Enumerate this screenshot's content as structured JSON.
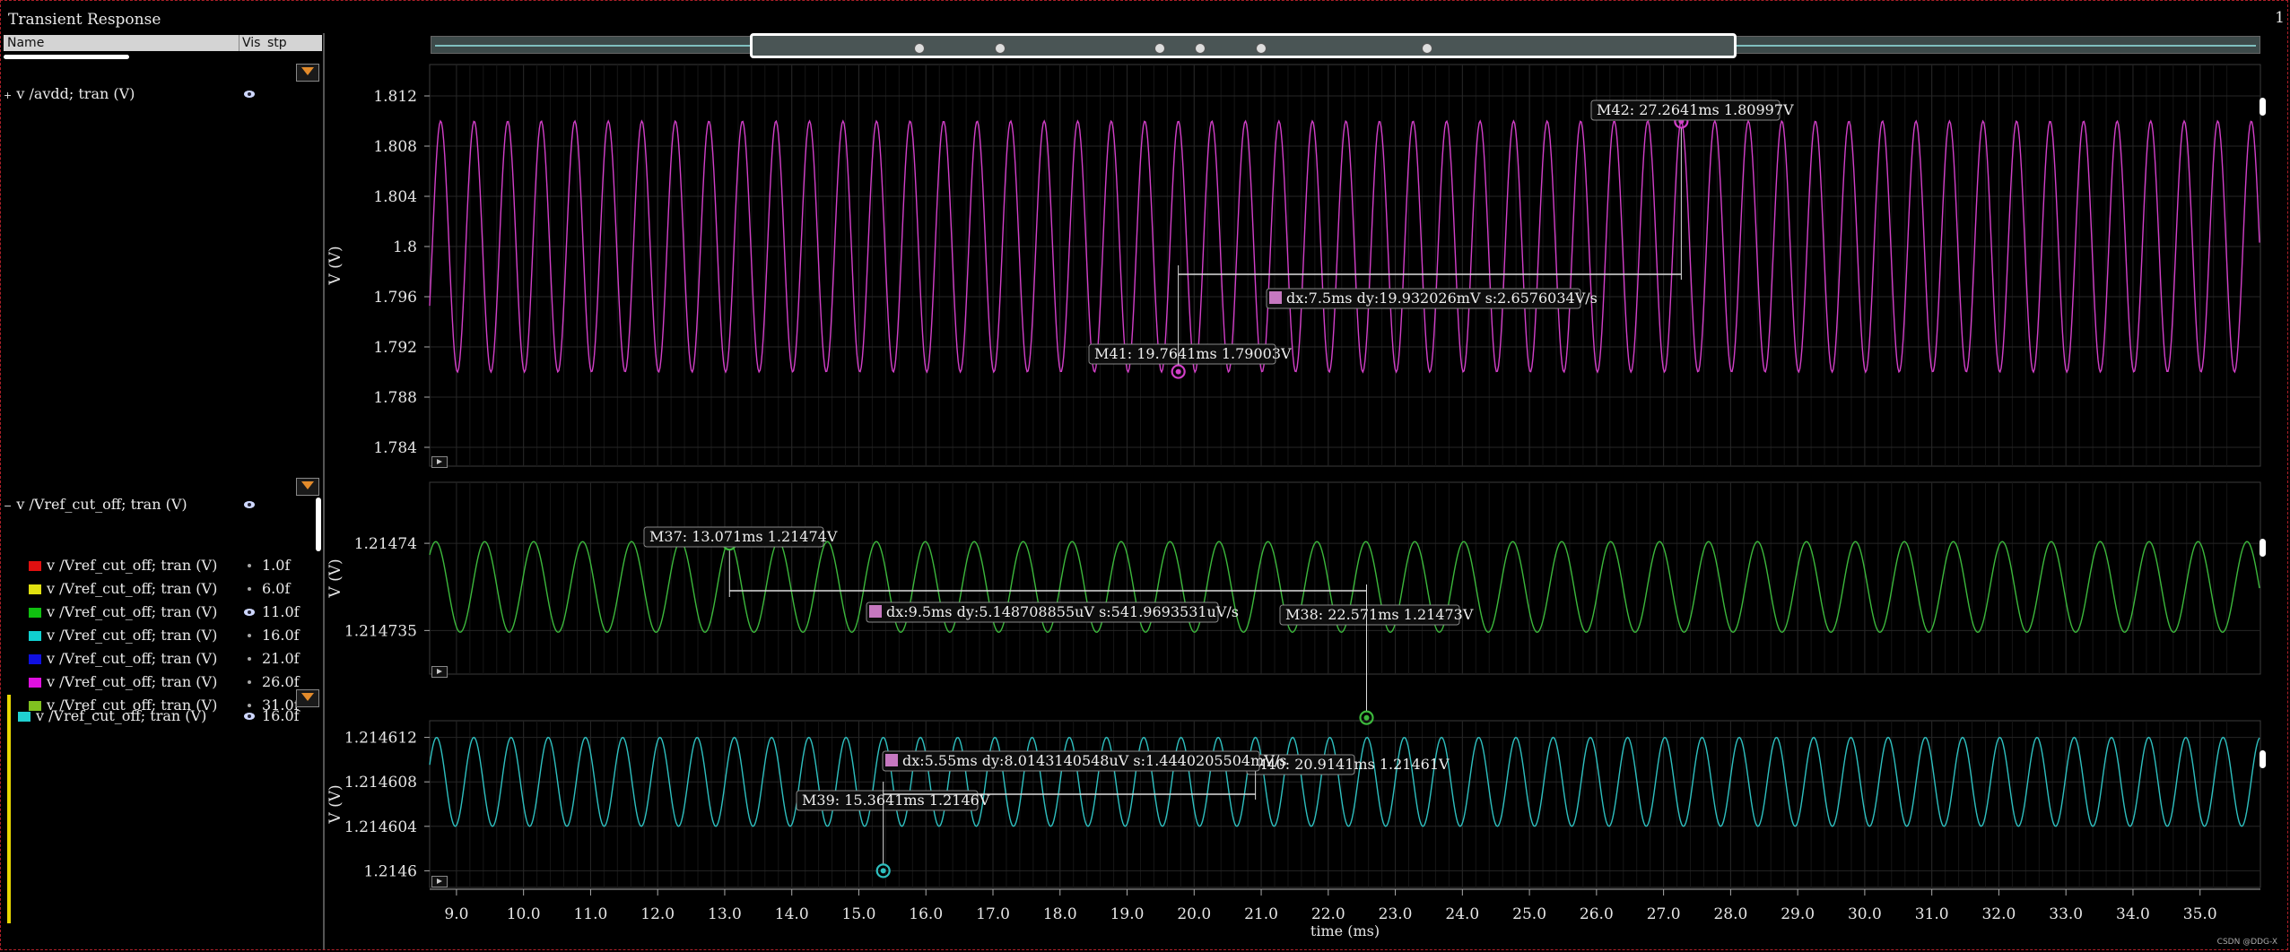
{
  "window": {
    "title": "Transient Response",
    "page_indicator": "1",
    "credit": "CSDN @DDG-X"
  },
  "browser": {
    "col_name": "Name",
    "col_vis": "Vis",
    "col_stp": "stp",
    "groups": [
      {
        "label": "v /avdd; tran (V)",
        "expand": "+"
      },
      {
        "label": "v /Vref_cut_off; tran (V)",
        "expand": "−",
        "children": [
          {
            "label": "v /Vref_cut_off; tran (V)",
            "stp": "1.0f",
            "color": "#e01010",
            "visible": false
          },
          {
            "label": "v /Vref_cut_off; tran (V)",
            "stp": "6.0f",
            "color": "#e0e010",
            "visible": false
          },
          {
            "label": "v /Vref_cut_off; tran (V)",
            "stp": "11.0f",
            "color": "#10c010",
            "visible": true
          },
          {
            "label": "v /Vref_cut_off; tran (V)",
            "stp": "16.0f",
            "color": "#10d0d0",
            "visible": false
          },
          {
            "label": "v /Vref_cut_off; tran (V)",
            "stp": "21.0f",
            "color": "#1010e0",
            "visible": false
          },
          {
            "label": "v /Vref_cut_off; tran (V)",
            "stp": "26.0f",
            "color": "#e010e0",
            "visible": false
          },
          {
            "label": "v /Vref_cut_off; tran (V)",
            "stp": "31.0f",
            "color": "#80c020",
            "visible": false
          }
        ]
      },
      {
        "label": "v /Vref_cut_off; tran (V)",
        "stp": "16.0f",
        "color": "#20d0d0"
      }
    ]
  },
  "colors": {
    "avdd": "#d23fc8",
    "vref_green": "#3cb83c",
    "vref_cyan": "#2ec0c0",
    "grid": "#262626",
    "axis_text": "#e6e6e6"
  },
  "chart_data": [
    {
      "type": "line",
      "ylabel": "V (V)",
      "series": [
        {
          "name": "v /avdd; tran (V)",
          "mean": 1.8,
          "amplitude": 0.01,
          "period_ms": 0.5
        }
      ],
      "yticks": [
        "1.812",
        "1.808",
        "1.804",
        "1.8",
        "1.796",
        "1.792",
        "1.788",
        "1.784"
      ],
      "ylim": [
        1.7825,
        1.8145
      ],
      "markers": [
        {
          "label": "M42: 27.2641ms 1.80997V",
          "x": 27.2641,
          "y": 1.80997
        },
        {
          "label": "M41: 19.7641ms 1.79003V",
          "x": 19.7641,
          "y": 1.79003
        }
      ],
      "delta": "dx:7.5ms dy:19.932026mV s:2.6576034V/s"
    },
    {
      "type": "line",
      "ylabel": "V (V)",
      "series": [
        {
          "name": "v /Vref_cut_off; tran (V)",
          "stp": "11.0f",
          "mean": 1.2147375,
          "amplitude": 2.6e-06,
          "period_ms": 0.73
        }
      ],
      "yticks": [
        "1.21474",
        "1.214735"
      ],
      "markers": [
        {
          "label": "M37: 13.071ms 1.21474V",
          "x": 13.071,
          "y": 1.21474
        },
        {
          "label": "M38: 22.571ms 1.21473V",
          "x": 22.571,
          "y": 1.21473
        }
      ],
      "delta": "dx:9.5ms dy:5.148708855uV s:541.9693531uV/s"
    },
    {
      "type": "line",
      "ylabel": "V (V)",
      "xlabel": "time (ms)",
      "series": [
        {
          "name": "v /Vref_cut_off; tran (V)",
          "stp": "16.0f",
          "mean": 1.214608,
          "amplitude": 4e-06,
          "period_ms": 0.555
        }
      ],
      "yticks": [
        "1.214612",
        "1.214608",
        "1.214604",
        "1.2146"
      ],
      "markers": [
        {
          "label": "M39: 15.3641ms 1.2146V",
          "x": 15.3641,
          "y": 1.2146
        },
        {
          "label": "M40: 20.9141ms 1.21461V",
          "x": 20.9141,
          "y": 1.21461
        }
      ],
      "delta": "dx:5.55ms dy:8.0143140548uV s:1.4440205504mV/s",
      "xlim": [
        8.6,
        35.9
      ],
      "xticks": [
        "9.0",
        "10.0",
        "11.0",
        "12.0",
        "13.0",
        "14.0",
        "15.0",
        "16.0",
        "17.0",
        "18.0",
        "19.0",
        "20.0",
        "21.0",
        "22.0",
        "23.0",
        "24.0",
        "25.0",
        "26.0",
        "27.0",
        "28.0",
        "29.0",
        "30.0",
        "31.0",
        "32.0",
        "33.0",
        "34.0",
        "35.0"
      ]
    }
  ]
}
